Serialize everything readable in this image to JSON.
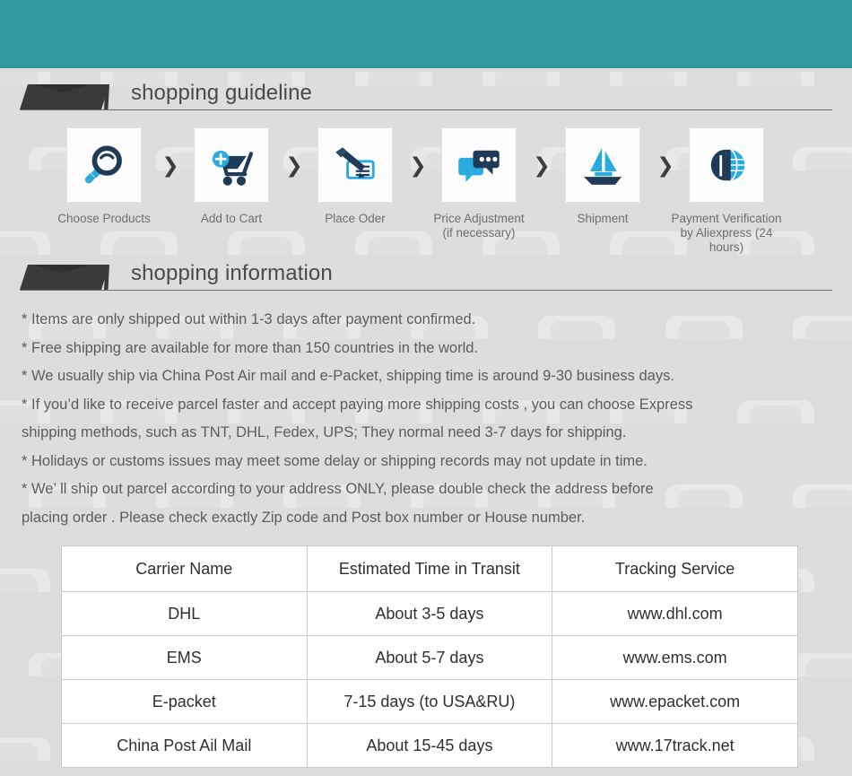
{
  "theme": {
    "teal_bar_color": "#319a9e",
    "page_background": "#dddddd",
    "banner_color": "#3a3a3a",
    "icon_dark_color": "#1f3b57",
    "icon_light_color": "#29abe2",
    "text_color": "#5c5c5c"
  },
  "sections": {
    "guideline": {
      "title": "shopping guideline"
    },
    "information": {
      "title": "shopping information"
    }
  },
  "steps": [
    {
      "icon": "magnifier-icon",
      "label": "Choose Products"
    },
    {
      "icon": "add-to-cart-icon",
      "label": "Add to Cart"
    },
    {
      "icon": "pen-check-icon",
      "label": "Place Oder"
    },
    {
      "icon": "chat-bubbles-icon",
      "label": "Price Adjustment\n(if necessary)"
    },
    {
      "icon": "sailboat-icon",
      "label": "Shipment"
    },
    {
      "icon": "dollar-globe-icon",
      "label": "Payment Verification\nby  Aliexpress (24 hours)"
    }
  ],
  "step_separator": "❯",
  "bullets": [
    "* Items are only shipped out within 1-3 days after payment confirmed.",
    "* Free shipping are available for more than 150 countries in the world.",
    "* We usually ship via China Post Air mail and e-Packet, shipping time is around 9-30 business days.",
    "* If you’d like to receive parcel faster and accept paying more shipping costs , you can choose Express\n   shipping methods, such as TNT, DHL, Fedex, UPS; They normal need 3-7 days for shipping.",
    "* Holidays or customs issues may meet some delay or shipping records may not update in time.",
    "* We’ ll ship out parcel according to your address ONLY, please double check the address before\n   placing order . Please check exactly Zip code and Post box number or House number."
  ],
  "carrier_table": {
    "headers": [
      "Carrier Name",
      "Estimated Time in Transit",
      "Tracking Service"
    ],
    "rows": [
      [
        "DHL",
        "About 3-5 days",
        "www.dhl.com"
      ],
      [
        "EMS",
        "About 5-7 days",
        "www.ems.com"
      ],
      [
        "E-packet",
        "7-15 days (to USA&RU)",
        "www.epacket.com"
      ],
      [
        "China Post Ail Mail",
        "About 15-45 days",
        "www.17track.net"
      ]
    ]
  }
}
